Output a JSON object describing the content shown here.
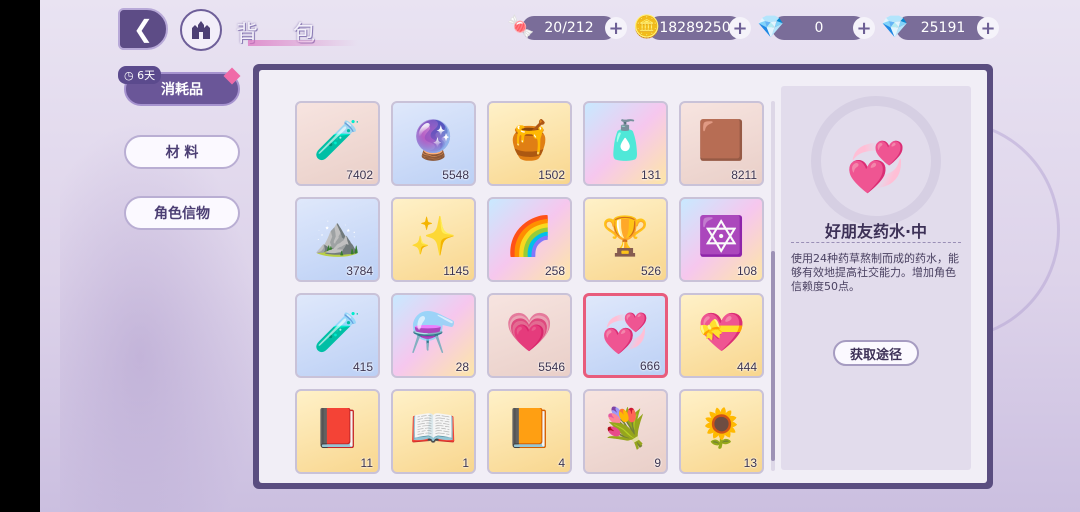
{
  "header": {
    "title": "背 包",
    "back_icon": "back-arrow-icon",
    "home_icon": "castle-icon"
  },
  "currencies": [
    {
      "name": "candy",
      "icon": "🍬",
      "value": "20/212"
    },
    {
      "name": "coin",
      "icon": "🪙",
      "value": "18289250"
    },
    {
      "name": "pink-diamond",
      "icon": "💎",
      "value": "0"
    },
    {
      "name": "blue-diamond",
      "icon": "💎",
      "value": "25191"
    }
  ],
  "tabs": [
    {
      "label": "消耗品",
      "active": true,
      "badge": "6天"
    },
    {
      "label": "材 料",
      "active": false
    },
    {
      "label": "角色信物",
      "active": false
    }
  ],
  "items": [
    {
      "icon": "🧪",
      "qty": "7402",
      "rarity": "common"
    },
    {
      "icon": "🔮",
      "qty": "5548",
      "rarity": "blue"
    },
    {
      "icon": "🍯",
      "qty": "1502",
      "rarity": "gold"
    },
    {
      "icon": "🧴",
      "qty": "131",
      "rarity": "rainbow"
    },
    {
      "icon": "🟫",
      "qty": "8211",
      "rarity": "common"
    },
    {
      "icon": "⛰️",
      "qty": "3784",
      "rarity": "blue"
    },
    {
      "icon": "✨",
      "qty": "1145",
      "rarity": "gold"
    },
    {
      "icon": "🌈",
      "qty": "258",
      "rarity": "rainbow"
    },
    {
      "icon": "🏆",
      "qty": "526",
      "rarity": "gold"
    },
    {
      "icon": "🔯",
      "qty": "108",
      "rarity": "rainbow"
    },
    {
      "icon": "🧪",
      "qty": "415",
      "rarity": "blue"
    },
    {
      "icon": "⚗️",
      "qty": "28",
      "rarity": "rainbow"
    },
    {
      "icon": "💗",
      "qty": "5546",
      "rarity": "common"
    },
    {
      "icon": "💞",
      "qty": "666",
      "rarity": "blue",
      "selected": true
    },
    {
      "icon": "💝",
      "qty": "444",
      "rarity": "gold"
    },
    {
      "icon": "📕",
      "qty": "11",
      "rarity": "gold"
    },
    {
      "icon": "📖",
      "qty": "1",
      "rarity": "gold"
    },
    {
      "icon": "📙",
      "qty": "4",
      "rarity": "gold"
    },
    {
      "icon": "💐",
      "qty": "9",
      "rarity": "common"
    },
    {
      "icon": "🌻",
      "qty": "13",
      "rarity": "gold"
    }
  ],
  "detail": {
    "icon": "💞",
    "name": "好朋友药水·中",
    "description": "使用24种药草熬制而成的药水，能够有效地提高社交能力。增加角色信赖度50点。",
    "obtain_label": "获取途径"
  }
}
